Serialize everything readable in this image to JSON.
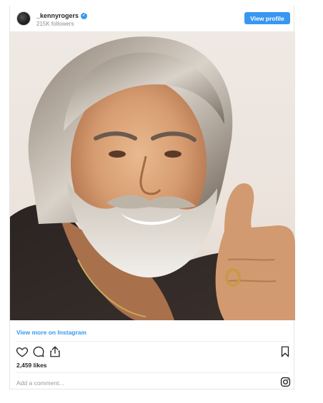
{
  "header": {
    "username": "_kennyrogers",
    "followers": "215K followers",
    "view_profile_label": "View profile",
    "verified_icon": "verified-badge-icon"
  },
  "post": {
    "image_alt": "kennyrogers",
    "view_more_label": "View more on Instagram",
    "likes": "2,459 likes"
  },
  "comment": {
    "placeholder": "Add a comment..."
  },
  "icons": {
    "like": "heart-icon",
    "comment": "comment-icon",
    "share": "share-icon",
    "save": "bookmark-icon",
    "instagram": "instagram-icon"
  },
  "colors": {
    "accent": "#3897f0",
    "text": "#262626",
    "muted": "#8e8e8e"
  }
}
